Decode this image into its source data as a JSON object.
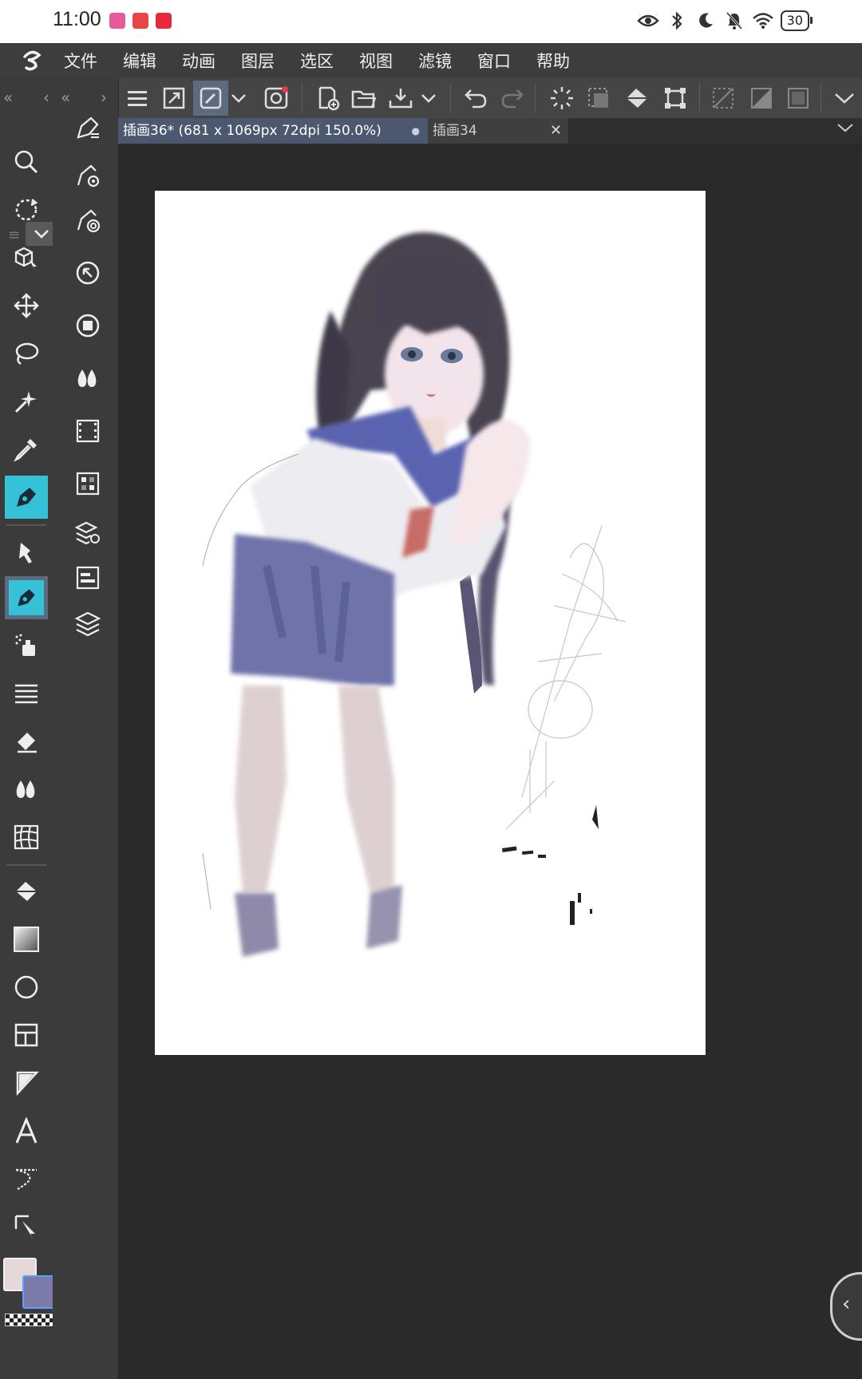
{
  "status_bar": {
    "time": "11:00",
    "battery": "30"
  },
  "menu": {
    "items": [
      "文件",
      "编辑",
      "动画",
      "图层",
      "选区",
      "视图",
      "滤镜",
      "窗口",
      "帮助"
    ]
  },
  "tabs": [
    {
      "label": "插画36* (681 x 1069px 72dpi 150.0%)",
      "modified_dot": "●"
    },
    {
      "label": "插画34",
      "close": "✕"
    }
  ],
  "colors": {
    "foreground": "#e6d8d8",
    "background": "#7c7aa8",
    "accent": "#5d6b80",
    "active_tool": "#35c2d8"
  },
  "tools": [
    "zoom-icon",
    "rotate-icon",
    "3d-object-icon",
    "move-icon",
    "lasso-icon",
    "magic-wand-icon",
    "eyedropper-icon",
    "pen-icon",
    "g-pen-icon",
    "pen-active-icon",
    "airbrush-icon",
    "lines-icon",
    "eraser-icon",
    "blend-icon",
    "mesh-icon",
    "fill-icon",
    "gradient-icon",
    "ellipse-icon",
    "frame-icon",
    "ruler-icon",
    "text-icon",
    "balloon-icon",
    "correct-line-icon"
  ]
}
